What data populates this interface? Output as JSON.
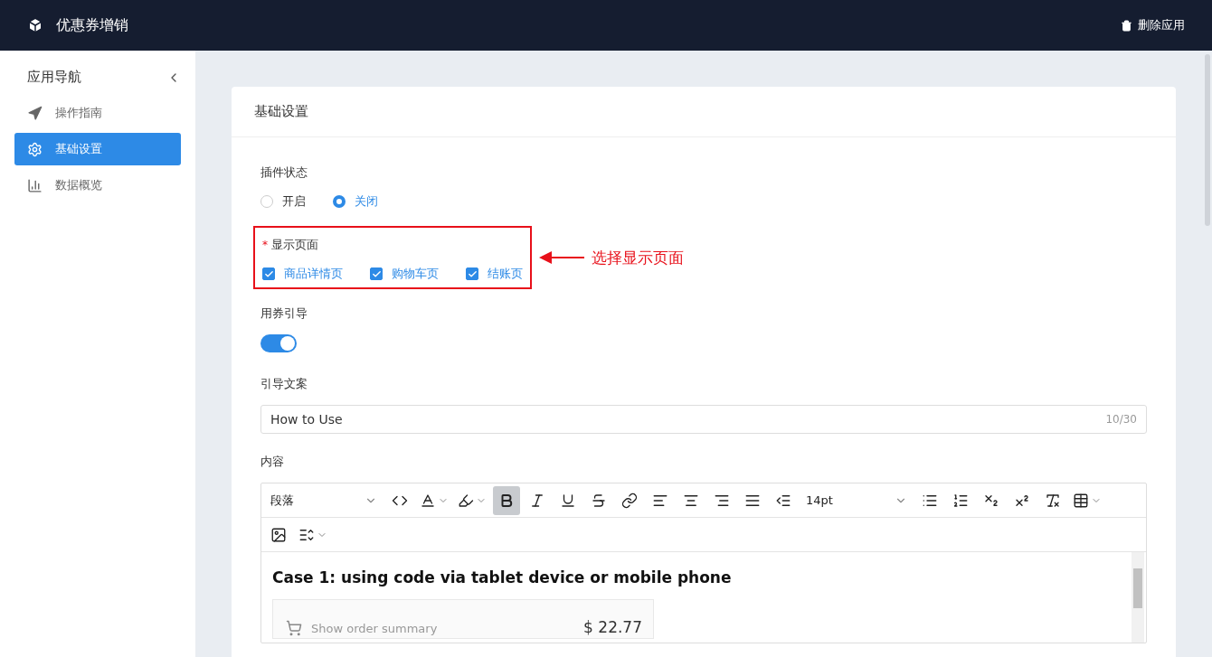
{
  "header": {
    "app_title": "优惠券增销",
    "delete_button": "删除应用"
  },
  "sidebar": {
    "title": "应用导航",
    "items": [
      {
        "label": "操作指南",
        "kind": "guide",
        "selected": false
      },
      {
        "label": "基础设置",
        "kind": "settings",
        "selected": true
      },
      {
        "label": "数据概览",
        "kind": "stats",
        "selected": false
      }
    ]
  },
  "card": {
    "title": "基础设置"
  },
  "plugin_status": {
    "label": "插件状态",
    "options": [
      {
        "label": "开启",
        "selected": false
      },
      {
        "label": "关闭",
        "selected": true
      }
    ]
  },
  "display_pages": {
    "label": "显示页面",
    "required_mark": "*",
    "options": [
      {
        "label": "商品详情页",
        "checked": true
      },
      {
        "label": "购物车页",
        "checked": true
      },
      {
        "label": "结账页",
        "checked": true
      }
    ],
    "annotation": "选择显示页面"
  },
  "coupon_guide": {
    "label": "用券引导",
    "on": true
  },
  "guide_text": {
    "label": "引导文案",
    "value": "How to Use",
    "counter": "10/30"
  },
  "content": {
    "label": "内容",
    "toolbar": [
      {
        "kind": "block-format",
        "label": "段落",
        "selected": false
      },
      {
        "kind": "code",
        "selected": false
      },
      {
        "kind": "text-color",
        "selected": false
      },
      {
        "kind": "highlight",
        "selected": false
      },
      {
        "kind": "bold",
        "selected": true
      },
      {
        "kind": "italic",
        "selected": false
      },
      {
        "kind": "underline",
        "selected": false
      },
      {
        "kind": "strikethrough",
        "selected": false
      },
      {
        "kind": "link",
        "selected": false
      },
      {
        "kind": "align-left",
        "selected": false
      },
      {
        "kind": "align-center",
        "selected": false
      },
      {
        "kind": "align-right",
        "selected": false
      },
      {
        "kind": "justify",
        "selected": false
      },
      {
        "kind": "outdent",
        "selected": false
      },
      {
        "kind": "font-size",
        "label": "14pt",
        "selected": false
      },
      {
        "kind": "bullet-list",
        "selected": false
      },
      {
        "kind": "numbered-list",
        "selected": false
      },
      {
        "kind": "subscript",
        "selected": false
      },
      {
        "kind": "superscript",
        "selected": false
      },
      {
        "kind": "clear-format",
        "selected": false
      },
      {
        "kind": "table",
        "selected": false
      },
      {
        "kind": "image",
        "selected": false
      },
      {
        "kind": "line-height",
        "selected": false
      }
    ],
    "heading": "Case 1: using code via tablet device or mobile phone",
    "summary_label": "Show order summary",
    "summary_price": "$ 22.77"
  }
}
